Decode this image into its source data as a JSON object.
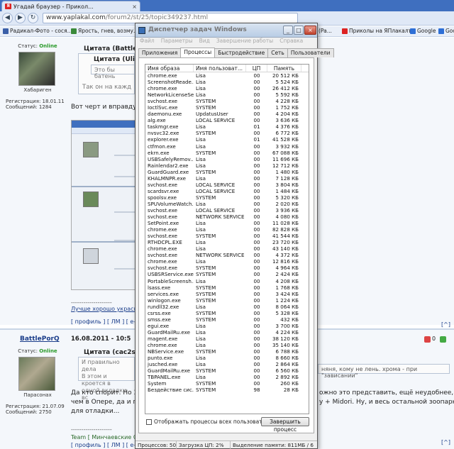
{
  "browser": {
    "tab_title": "Угадай браузер - Прикол...",
    "tab_close": "×",
    "url_host": "www.yaplakal.com",
    "url_path": "/forum2/st/25/topic349237.html",
    "nav": {
      "back": "◀",
      "forward": "▶",
      "reload": "↻"
    },
    "bookmarks": [
      {
        "label": "Радикал-Фото - сося...",
        "color": "#3a5fa8"
      },
      {
        "label": "Ярость, гнев, возму...",
        "color": "#3a8a3a"
      },
      {
        "label": "(Pa...",
        "color": "#3a5fa8"
      },
      {
        "label": "Приколы на ЯПлакалъ",
        "color": "#d22"
      },
      {
        "label": "Google",
        "color": "#2e6fd6"
      },
      {
        "label": "Google",
        "color": "#2e6fd6"
      }
    ]
  },
  "forum": {
    "post1": {
      "status_label": "Статус:",
      "status_value": "Online",
      "nick_caption": "Хабариген",
      "reg_label": "Регистрация: 18.01.11",
      "msgs_label": "Сообщений: 1284",
      "quote_outer_title": "Цитата (BattlePo",
      "quote_inner_title": "Цитата (Ulizi",
      "quote_inner_text": "Это бы батень",
      "quote_outer_text": "Так он на кажд",
      "body": "Вот черт и вправду",
      "sig_divider": "--------------------",
      "sig_text": "Лучше хорошо укрась",
      "links": "[ профиль ] [ ЛМ ] [ е-"
    },
    "post2": {
      "nick": "BattlePorQ",
      "date": "16.08.2011 - 10:5",
      "status_label": "Статус:",
      "status_value": "Online",
      "nick_caption": "Парасонах",
      "reg_label": "Регистрация: 21.07.09",
      "msgs_label": "Сообщений: 2750",
      "quote_title": "Цитата (cac2s @",
      "quote_lines": [
        "И правильно дела",
        "В этом и кроется в",
        "одной вкладки вс"
      ],
      "quote_right": "няня, кому не лень. хрома - при \"зависании\"",
      "body_line1": "Да кто спорит. Но 3",
      "body_line2": "чем в Опере, да и г",
      "body_line3": "для отладки...",
      "body_right1": "ожно это представить, ещё неудобнее,",
      "body_right2": "у + Midori. Ну, и весь остальной зоопарк",
      "sig_divider": "--------------------",
      "team": "Team  [ Минчаевские Сн",
      "links": "[ профиль ] [ ЛМ ] [ е-",
      "votes": "0",
      "rating": "0"
    }
  },
  "taskmgr": {
    "title": "Диспетчер задач Windows",
    "menu": [
      "Файл",
      "Параметры",
      "Вид",
      "Завершение работы",
      "Справка"
    ],
    "tabs": [
      "Приложения",
      "Процессы",
      "Быстродействие",
      "Сеть",
      "Пользователи"
    ],
    "active_tab": 1,
    "columns": [
      "Имя образа",
      "Имя пользоват...",
      "ЦП",
      "Память"
    ],
    "processes": [
      [
        "chrome.exe",
        "Lisa",
        "00",
        "20 512 КБ"
      ],
      [
        "ScreenshotReade...",
        "Lisa",
        "00",
        "5 524 КБ"
      ],
      [
        "chrome.exe",
        "Lisa",
        "00",
        "26 412 КБ"
      ],
      [
        "NetworkLicenseSe...",
        "Lisa",
        "00",
        "5 592 КБ"
      ],
      [
        "svchost.exe",
        "SYSTEM",
        "00",
        "4 228 КБ"
      ],
      [
        "IoctlSvc.exe",
        "SYSTEM",
        "00",
        "1 752 КБ"
      ],
      [
        "daemonu.exe",
        "UpdatusUser",
        "00",
        "4 204 КБ"
      ],
      [
        "alg.exe",
        "LOCAL SERVICE",
        "00",
        "3 636 КБ"
      ],
      [
        "taskmgr.exe",
        "Lisa",
        "01",
        "4 376 КБ"
      ],
      [
        "nvsvc32.exe",
        "SYSTEM",
        "00",
        "6 772 КБ"
      ],
      [
        "explorer.exe",
        "Lisa",
        "01",
        "41 528 КБ"
      ],
      [
        "ctfmon.exe",
        "Lisa",
        "00",
        "3 932 КБ"
      ],
      [
        "ekrn.exe",
        "SYSTEM",
        "00",
        "67 088 КБ"
      ],
      [
        "USBSafelyRemov...",
        "Lisa",
        "00",
        "11 696 КБ"
      ],
      [
        "Rainlendar2.exe",
        "Lisa",
        "00",
        "12 712 КБ"
      ],
      [
        "GuardGuard.exe",
        "SYSTEM",
        "00",
        "1 480 КБ"
      ],
      [
        "KHALMNPR.exe",
        "Lisa",
        "00",
        "7 128 КБ"
      ],
      [
        "svchost.exe",
        "LOCAL SERVICE",
        "00",
        "3 804 КБ"
      ],
      [
        "scardsvr.exe",
        "LOCAL SERVICE",
        "00",
        "1 484 КБ"
      ],
      [
        "spoolsv.exe",
        "SYSTEM",
        "00",
        "5 320 КБ"
      ],
      [
        "SPUVolumeWatch...",
        "Lisa",
        "00",
        "2 020 КБ"
      ],
      [
        "svchost.exe",
        "LOCAL SERVICE",
        "00",
        "3 936 КБ"
      ],
      [
        "svchost.exe",
        "NETWORK SERVICE",
        "00",
        "4 080 КБ"
      ],
      [
        "SetPoint.exe",
        "Lisa",
        "00",
        "11 028 КБ"
      ],
      [
        "chrome.exe",
        "Lisa",
        "00",
        "82 828 КБ"
      ],
      [
        "svchost.exe",
        "SYSTEM",
        "00",
        "41 544 КБ"
      ],
      [
        "RTHDCPL.EXE",
        "Lisa",
        "00",
        "23 720 КБ"
      ],
      [
        "chrome.exe",
        "Lisa",
        "00",
        "43 140 КБ"
      ],
      [
        "svchost.exe",
        "NETWORK SERVICE",
        "00",
        "4 372 КБ"
      ],
      [
        "chrome.exe",
        "Lisa",
        "00",
        "12 816 КБ"
      ],
      [
        "svchost.exe",
        "SYSTEM",
        "00",
        "4 964 КБ"
      ],
      [
        "USBSRService.exe",
        "SYSTEM",
        "00",
        "2 424 КБ"
      ],
      [
        "PortableScreensh...",
        "Lisa",
        "00",
        "4 208 КБ"
      ],
      [
        "lsass.exe",
        "SYSTEM",
        "00",
        "1 768 КБ"
      ],
      [
        "services.exe",
        "SYSTEM",
        "00",
        "3 424 КБ"
      ],
      [
        "winlogon.exe",
        "SYSTEM",
        "00",
        "1 224 КБ"
      ],
      [
        "rundll32.exe",
        "Lisa",
        "00",
        "8 064 КБ"
      ],
      [
        "csrss.exe",
        "SYSTEM",
        "00",
        "5 328 КБ"
      ],
      [
        "smss.exe",
        "SYSTEM",
        "00",
        "432 КБ"
      ],
      [
        "egui.exe",
        "Lisa",
        "00",
        "3 700 КБ"
      ],
      [
        "GuardMailRu.exe",
        "Lisa",
        "00",
        "4 224 КБ"
      ],
      [
        "magent.exe",
        "Lisa",
        "00",
        "38 120 КБ"
      ],
      [
        "chrome.exe",
        "Lisa",
        "00",
        "35 140 КБ"
      ],
      [
        "NBService.exe",
        "SYSTEM",
        "00",
        "6 788 КБ"
      ],
      [
        "punto.exe",
        "Lisa",
        "00",
        "8 660 КБ"
      ],
      [
        "jusched.exe",
        "Lisa",
        "00",
        "2 864 КБ"
      ],
      [
        "GuardMailRu.exe",
        "SYSTEM",
        "00",
        "6 560 КБ"
      ],
      [
        "TBPANEL.exe",
        "Lisa",
        "00",
        "2 892 КБ"
      ],
      [
        "System",
        "SYSTEM",
        "00",
        "260 КБ"
      ],
      [
        "Бездействие сис...",
        "SYSTEM",
        "98",
        "28 КБ"
      ]
    ],
    "show_all_label": "Отображать процессы всех пользователей",
    "end_process_label": "Завершить процесс",
    "status": {
      "processes": "Процессов: 50",
      "cpu": "Загрузка ЦП: 2%",
      "memory": "Выделение памяти: 811МБ / 6"
    }
  }
}
